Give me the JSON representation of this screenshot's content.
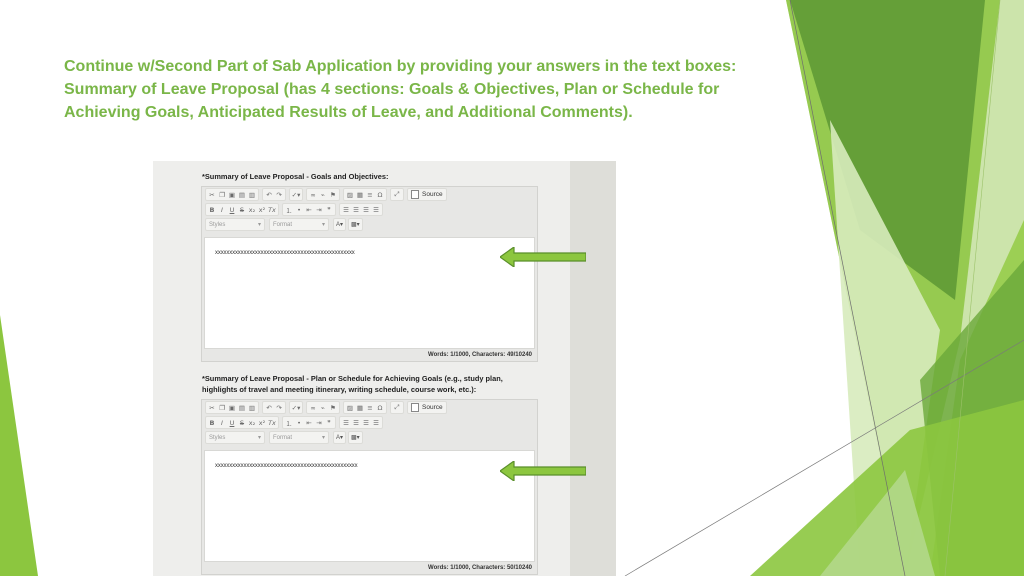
{
  "slide": {
    "title_lines": [
      "Continue w/Second Part of Sab Application by providing your answers in the text boxes:",
      "Summary of Leave Proposal (has 4 sections: Goals & Objectives, Plan or Schedule for",
      "Achieving Goals, Anticipated Results of Leave, and Additional Comments)."
    ]
  },
  "colors": {
    "title": "#7ab648",
    "arrow_fill": "#8cc63f",
    "arrow_stroke": "#5a8f2a",
    "green_light": "#c3df9c",
    "green_mid": "#8cc63f",
    "green_dark": "#4e8a2a"
  },
  "editor_common": {
    "source_label": "Source",
    "styles_label": "Styles",
    "format_label": "Format",
    "icons_row1": [
      "cut-icon",
      "copy-icon",
      "paste-icon",
      "paste-text-icon",
      "paste-word-icon",
      "undo-icon",
      "redo-icon",
      "spellcheck-icon",
      "link-icon",
      "unlink-icon",
      "anchor-icon",
      "image-icon",
      "table-icon",
      "horizontal-line-icon",
      "special-char-icon",
      "maximize-icon"
    ],
    "icons_row2": [
      "bold-icon",
      "italic-icon",
      "underline-icon",
      "strike-icon",
      "subscript-icon",
      "superscript-icon",
      "remove-format-icon",
      "numbered-list-icon",
      "bulleted-list-icon",
      "outdent-icon",
      "indent-icon",
      "blockquote-icon",
      "align-left-icon",
      "align-center-icon",
      "align-right-icon",
      "justify-icon"
    ]
  },
  "sections": [
    {
      "label": "*Summary of Leave Proposal - Goals and Objectives:",
      "content": "xxxxxxxxxxxxxxxxxxxxxxxxxxxxxxxxxxxxxxxxxxxxxxxxx",
      "status": "Words: 1/1000, Characters: 49/10240"
    },
    {
      "label_line1": "*Summary of Leave Proposal - Plan or Schedule for Achieving Goals (e.g., study plan,",
      "label_line2": "highlights of travel and meeting itinerary, writing schedule, course work, etc.):",
      "content": "xxxxxxxxxxxxxxxxxxxxxxxxxxxxxxxxxxxxxxxxxxxxxxxxxx",
      "status": "Words: 1/1000, Characters: 50/10240"
    }
  ]
}
